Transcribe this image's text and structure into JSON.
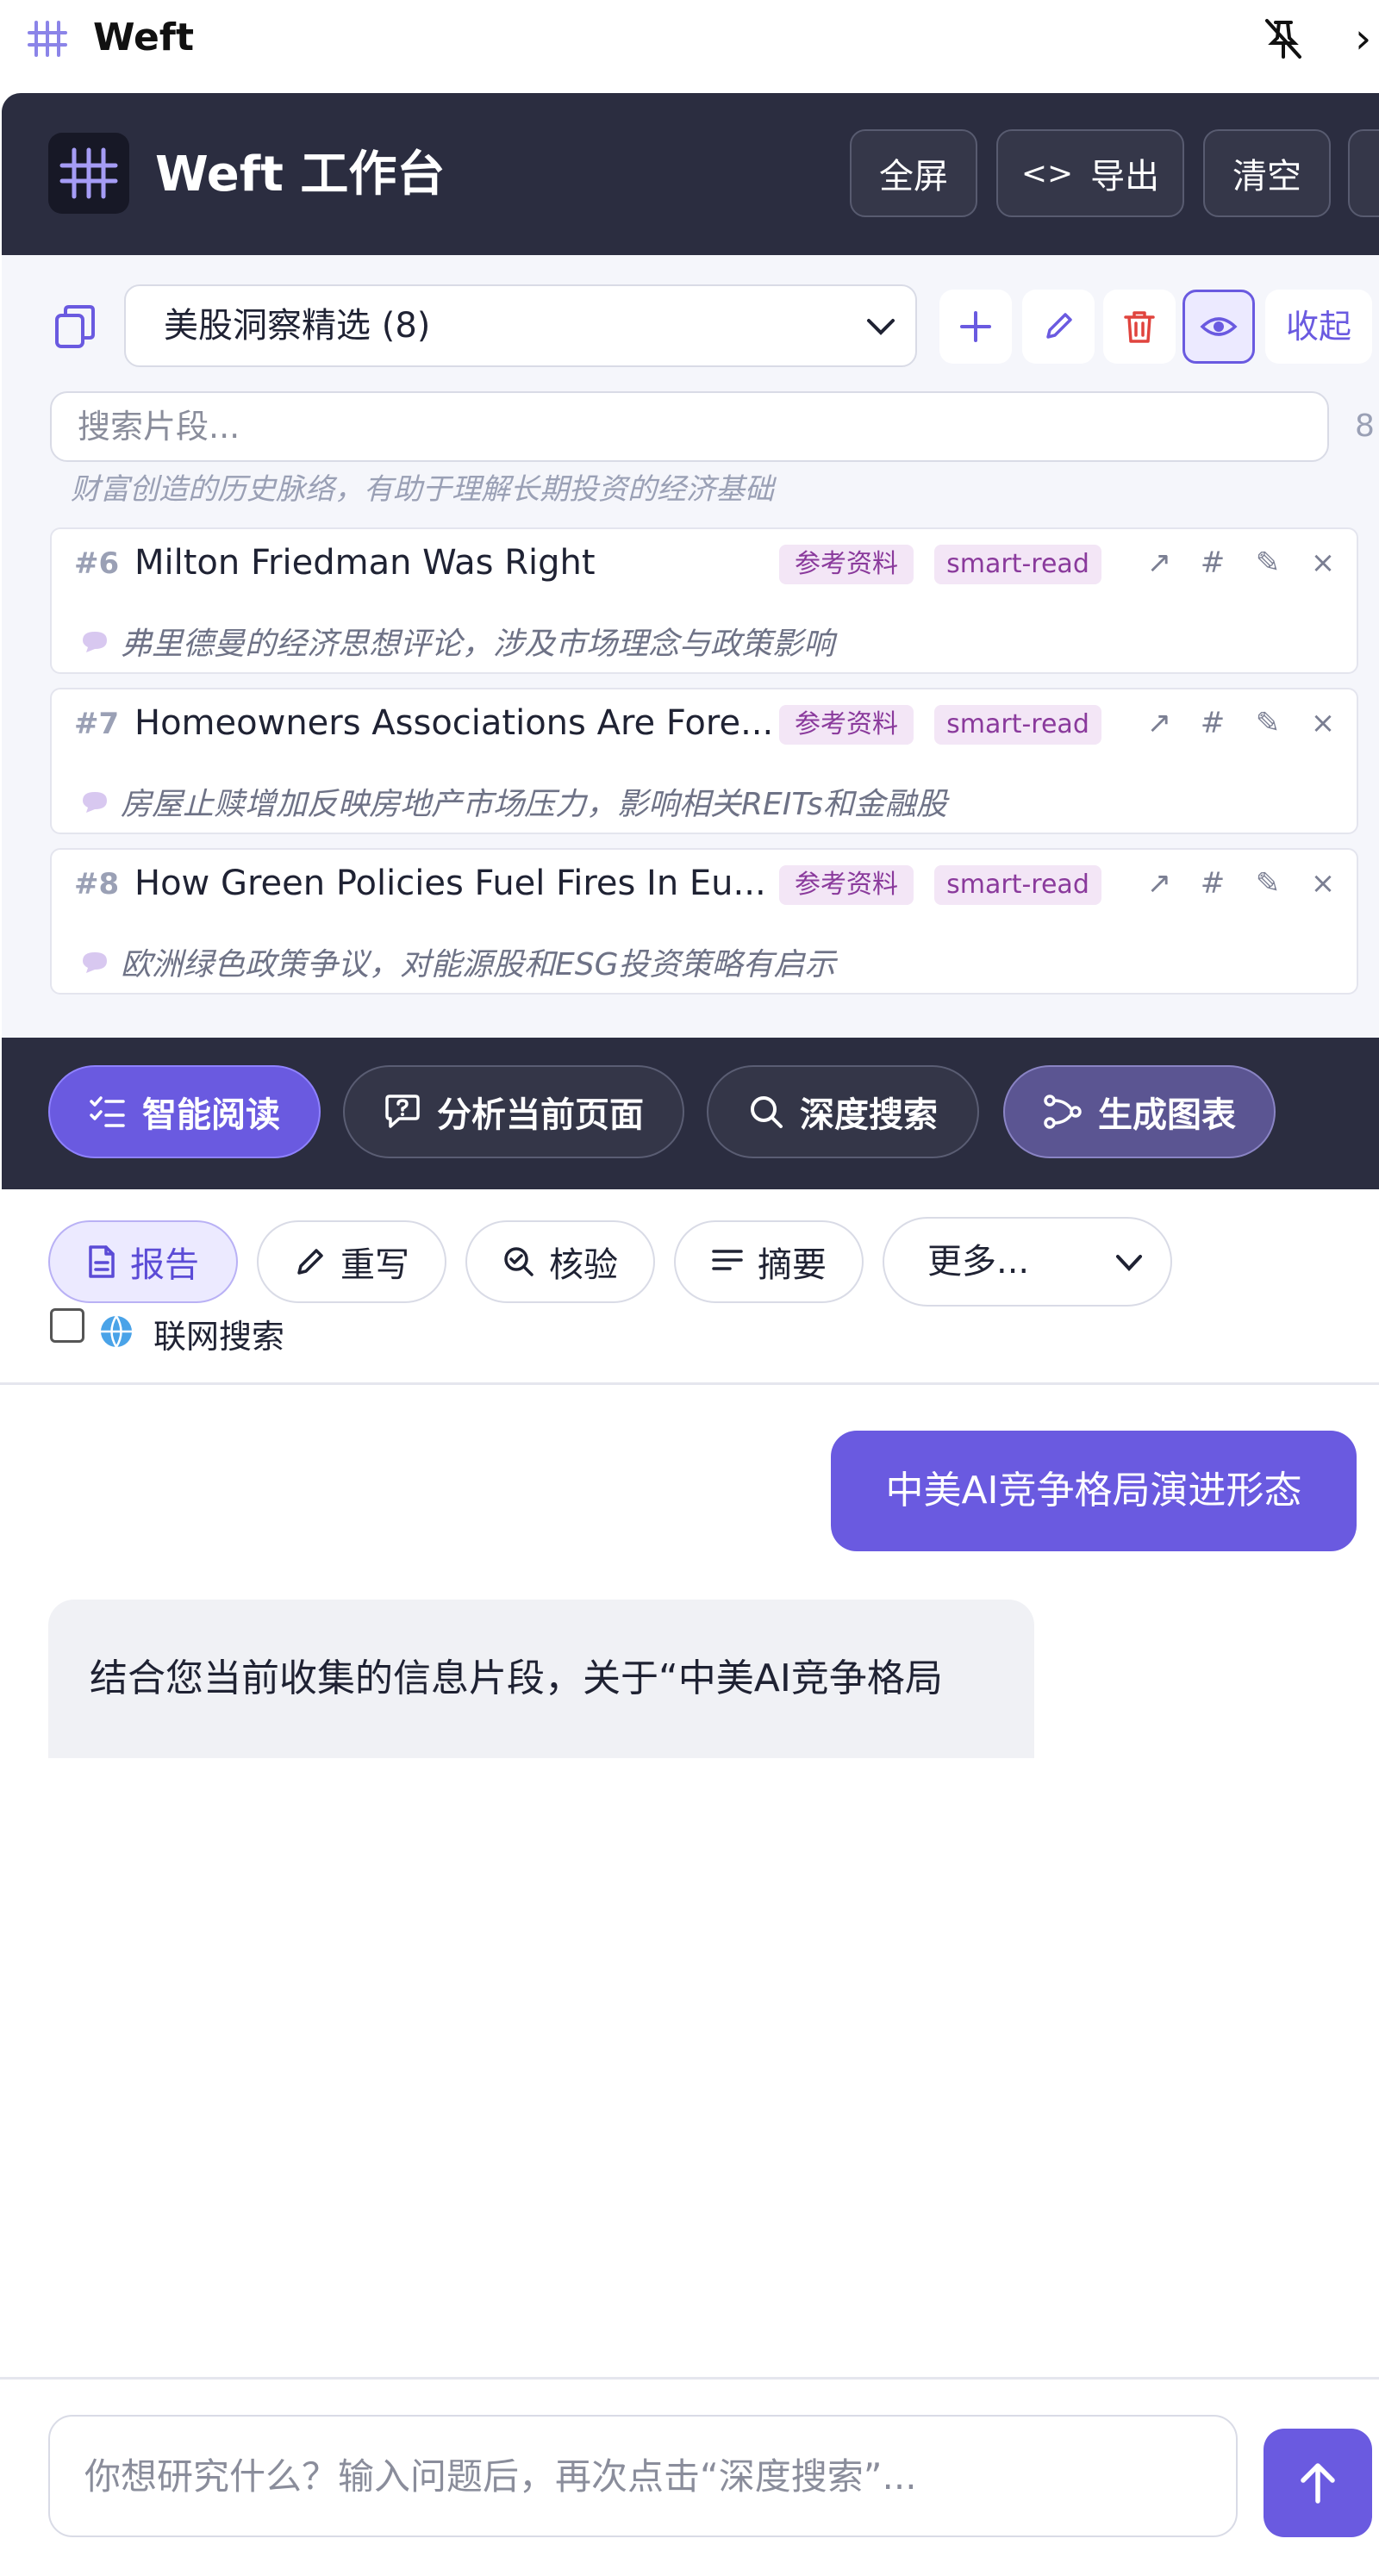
{
  "titlebar": {
    "title": "Weft"
  },
  "header": {
    "title": "Weft 工作台",
    "buttons": {
      "fullscreen": "全屏",
      "export": "导出",
      "clear": "清空"
    }
  },
  "collection": {
    "selected": "美股洞察精选 (8)",
    "collapse_label": "收起",
    "search_placeholder": "搜索片段...",
    "search_count": "8",
    "clipped_note": "财富创造的历史脉络，有助于理解长期投资的经济基础",
    "items": [
      {
        "num": "#6",
        "title": "Milton Friedman Was Right",
        "tag1": "参考资料",
        "tag2": "smart-read",
        "note": "弗里德曼的经济思想评论，涉及市场理念与政策影响"
      },
      {
        "num": "#7",
        "title": "Homeowners Associations Are Fore...",
        "tag1": "参考资料",
        "tag2": "smart-read",
        "note": "房屋止赎增加反映房地产市场压力，影响相关REITs和金融股"
      },
      {
        "num": "#8",
        "title": "How Green Policies Fuel Fires In Eu...",
        "tag1": "参考资料",
        "tag2": "smart-read",
        "note": "欧洲绿色政策争议，对能源股和ESG投资策略有启示"
      }
    ],
    "card_actions": {
      "open": "↗",
      "tag": "#",
      "edit": "✎",
      "remove": "×"
    }
  },
  "tools": {
    "smart_read": "智能阅读",
    "analyze_page": "分析当前页面",
    "deep_search": "深度搜索",
    "gen_chart": "生成图表"
  },
  "modes": {
    "report": "报告",
    "rewrite": "重写",
    "verify": "核验",
    "summary": "摘要",
    "more": "更多...",
    "web_search": "联网搜索"
  },
  "chat": {
    "user_message": "中美AI竞争格局演进形态",
    "ai_message": "结合您当前收集的信息片段，关于“中美AI竞争格局",
    "input_placeholder": "你想研究什么？输入问题后，再次点击“深度搜索”..."
  },
  "colors": {
    "accent": "#6a5ae0",
    "header_bg": "#2b2d40",
    "danger": "#e0443e"
  }
}
